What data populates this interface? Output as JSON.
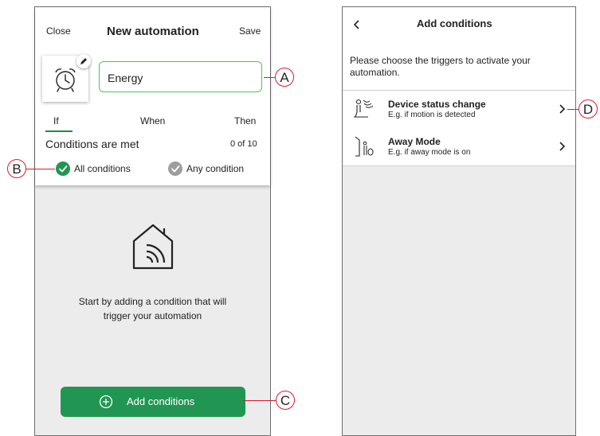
{
  "left": {
    "header": {
      "close": "Close",
      "title": "New automation",
      "save": "Save"
    },
    "name_value": "Energy",
    "tabs": [
      "If",
      "When",
      "Then"
    ],
    "conditions_label": "Conditions are met",
    "conditions_count": "0 of 10",
    "options": {
      "all": "All conditions",
      "any": "Any condition"
    },
    "empty_text_1": "Start by adding a condition that will",
    "empty_text_2": "trigger your automation",
    "add_button": "Add conditions"
  },
  "right": {
    "title": "Add conditions",
    "instruction_1": "Please choose the triggers to activate your",
    "instruction_2": "automation.",
    "items": [
      {
        "title": "Device status change",
        "subtitle": "E.g. if motion is detected",
        "icon": "motion-sensor-icon"
      },
      {
        "title": "Away Mode",
        "subtitle": "E.g. if away mode is on",
        "icon": "away-mode-icon"
      }
    ]
  },
  "callouts": [
    "A",
    "B",
    "C",
    "D"
  ],
  "colors": {
    "accent": "#219653",
    "field_border": "#3dcd58",
    "callout": "#d81b2f",
    "check_off": "#9e9e9e"
  }
}
